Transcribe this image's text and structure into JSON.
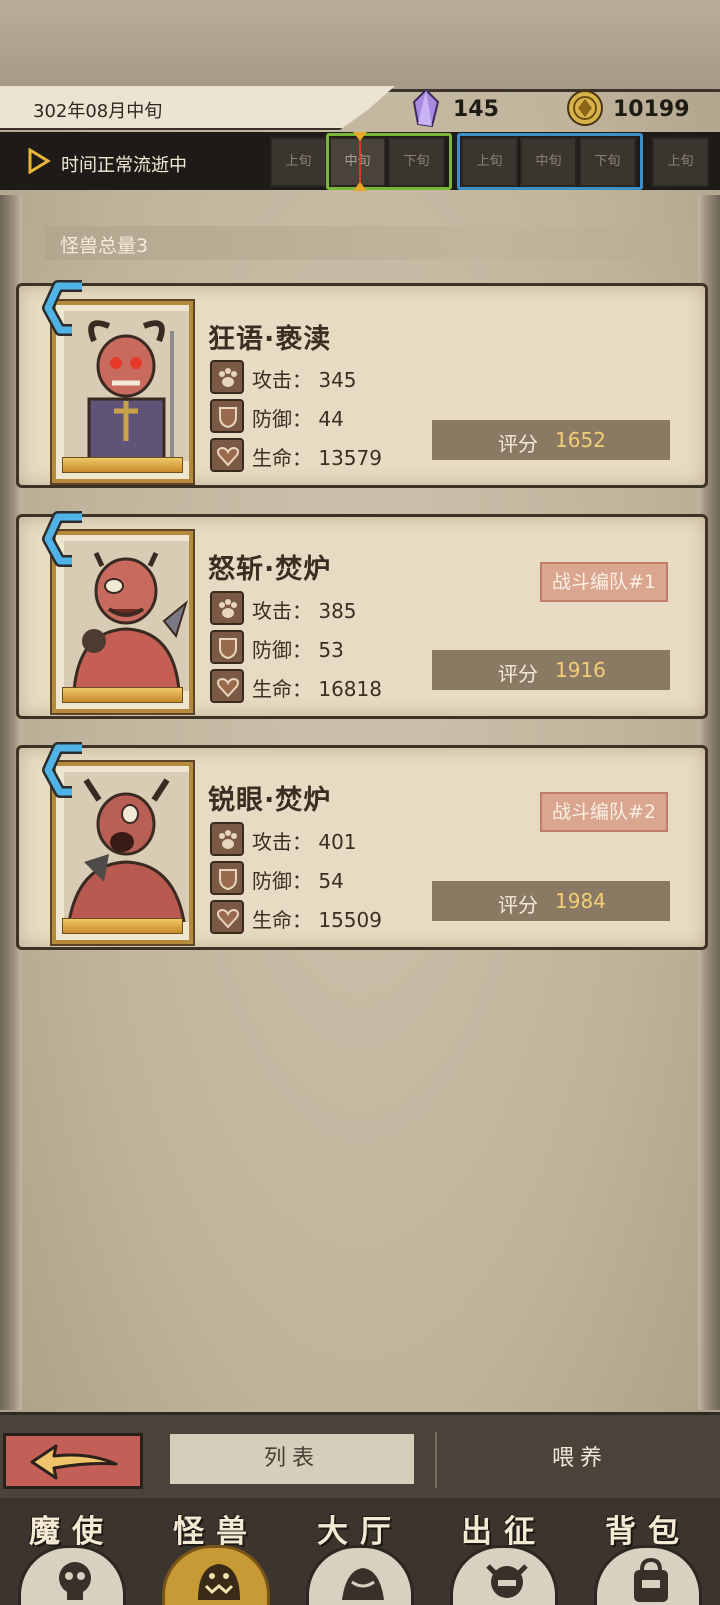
{
  "header": {
    "date": "302年08月中旬",
    "crystals": "145",
    "coins": "10199"
  },
  "timeline": {
    "status": "时间正常流逝中",
    "slots": [
      "上旬",
      "中旬",
      "下旬",
      "上旬",
      "中旬",
      "下旬",
      "上旬"
    ],
    "current_index": 1
  },
  "summary": {
    "total_label": "怪兽总量3"
  },
  "monsters": [
    {
      "name": "狂语·亵渎",
      "attack": "攻击： 345",
      "defense": "防御： 44",
      "hp": "生命： 13579",
      "score_label": "评分",
      "score": "1652",
      "team": ""
    },
    {
      "name": "怒斩·焚炉",
      "attack": "攻击： 385",
      "defense": "防御： 53",
      "hp": "生命： 16818",
      "score_label": "评分",
      "score": "1916",
      "team": "战斗编队#1"
    },
    {
      "name": "锐眼·焚炉",
      "attack": "攻击： 401",
      "defense": "防御： 54",
      "hp": "生命： 15509",
      "score_label": "评分",
      "score": "1984",
      "team": "战斗编队#2"
    }
  ],
  "tabs": {
    "list": "列表",
    "feed": "喂养"
  },
  "nav": {
    "items": [
      {
        "label": "魔使",
        "icon": "skull-icon"
      },
      {
        "label": "怪兽",
        "icon": "monster-icon"
      },
      {
        "label": "大厅",
        "icon": "hall-icon"
      },
      {
        "label": "出征",
        "icon": "battle-icon"
      },
      {
        "label": "背包",
        "icon": "backpack-icon"
      }
    ],
    "active_index": 1
  },
  "colors": {
    "accent_gold": "#f2cf76",
    "team_badge": "#dba690",
    "timeline_green": "#7ab63a",
    "timeline_blue": "#3d90c7"
  }
}
